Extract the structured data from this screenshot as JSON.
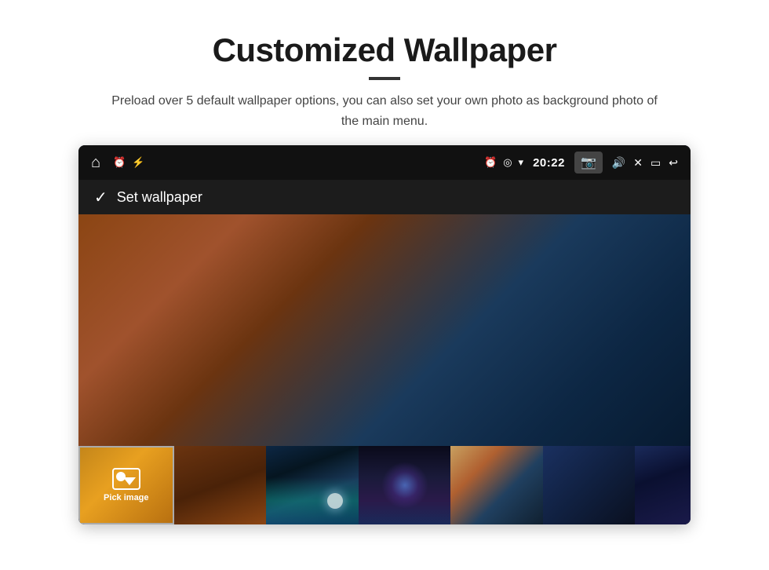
{
  "header": {
    "title": "Customized Wallpaper",
    "subtitle": "Preload over 5 default wallpaper options, you can also set your own photo as background photo of the main menu."
  },
  "statusBar": {
    "time": "20:22",
    "leftIcons": [
      "home",
      "clock",
      "usb"
    ],
    "rightIcons": [
      "alarm",
      "location",
      "wifi",
      "camera",
      "volume",
      "close",
      "window",
      "back"
    ]
  },
  "setWallpaperBar": {
    "checkmark": "✓",
    "label": "Set wallpaper"
  },
  "thumbnails": [
    {
      "id": "pick-image",
      "label": "Pick image"
    },
    {
      "id": "thumb-2",
      "label": ""
    },
    {
      "id": "thumb-3",
      "label": ""
    },
    {
      "id": "thumb-4",
      "label": ""
    },
    {
      "id": "thumb-5",
      "label": ""
    },
    {
      "id": "thumb-6",
      "label": ""
    },
    {
      "id": "thumb-7",
      "label": ""
    }
  ]
}
